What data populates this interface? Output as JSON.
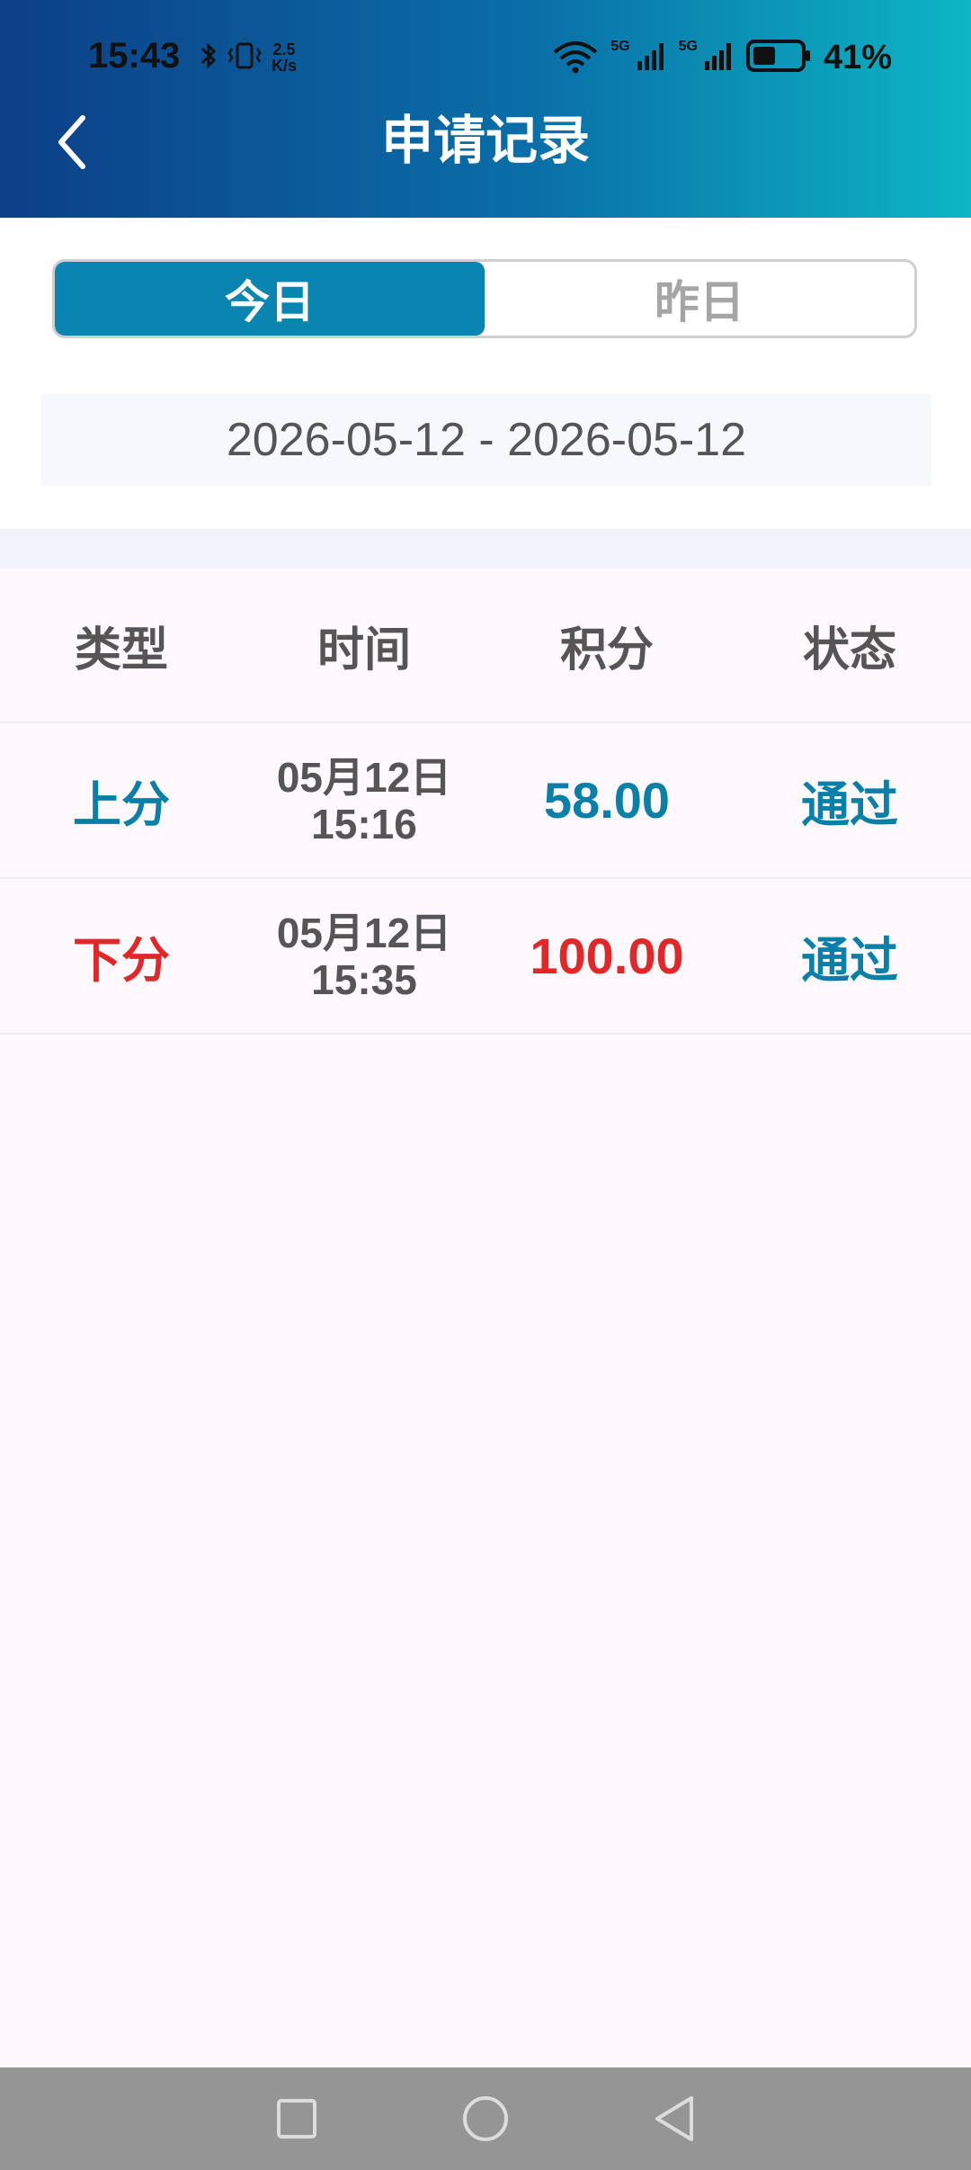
{
  "status_bar": {
    "time": "15:43",
    "net_speed_top": "2.5",
    "net_speed_bottom": "K/s",
    "sig1_label": "5G",
    "sig2_label": "5G",
    "battery_percent": "41%"
  },
  "header": {
    "title": "申请记录"
  },
  "tabs": [
    {
      "label": "今日",
      "active": true
    },
    {
      "label": "昨日",
      "active": false
    }
  ],
  "date_range": "2026-05-12 - 2026-05-12",
  "table": {
    "headers": [
      "类型",
      "时间",
      "积分",
      "状态"
    ],
    "rows": [
      {
        "type": "上分",
        "date": "05月12日",
        "time": "15:16",
        "points": "58.00",
        "status": "通过"
      },
      {
        "type": "下分",
        "date": "05月12日",
        "time": "15:35",
        "points": "100.00",
        "status": "通过"
      }
    ]
  },
  "colors": {
    "accent": "#0a84b0",
    "up": "#0a7fa8",
    "down": "#e0282a"
  },
  "nav_icons": [
    "recent-apps-icon",
    "home-icon",
    "back-icon"
  ]
}
